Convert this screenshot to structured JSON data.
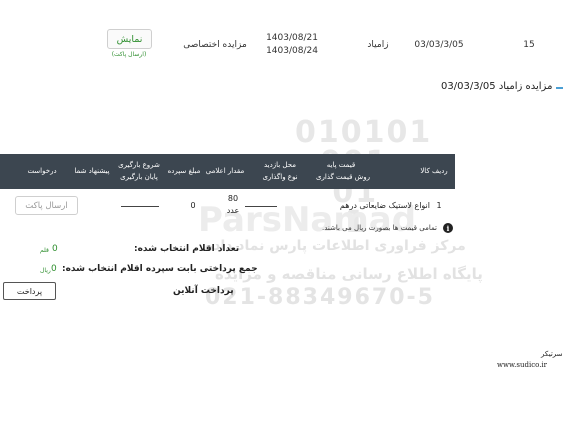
{
  "top_row": {
    "row_no": "15",
    "code": "03/03/3/05",
    "company": "زامیاد",
    "date_start": "1403/08/21",
    "date_end": "1403/08/24",
    "type": "مزایده اختصاصی",
    "show_label": "نمایش",
    "show_sub": "(ارسال پاکت)"
  },
  "section": {
    "title": "مزایده زامیاد 03/03/3/05"
  },
  "table": {
    "headers": {
      "row_item": "ردیف کالا",
      "base_price_line1": "قیمت پایه",
      "base_price_line2": "روش قیمت گذاری",
      "visit_line1": "محل بازدید",
      "visit_line2": "نوع واگذاری",
      "quantity": "مقدار اعلامی",
      "deposit": "مبلغ سپرده",
      "loading_line1": "شروع بارگیری",
      "loading_line2": "پایان بارگیری",
      "your_offer": "پیشنهاد شما",
      "request": "درخواست"
    },
    "row": {
      "index": "1",
      "item": "انواع لاستیک ضایعاتی درهم",
      "qty_value": "80",
      "qty_unit": "عدد",
      "deposit": "0",
      "send_label": "ارسال پاکت"
    }
  },
  "note": "تمامی قیمت ها بصورت ریال می باشند.",
  "summary": {
    "count_label": "تعداد اقلام انتخاب شده:",
    "count_value": "0",
    "count_unit": "قلم",
    "total_label": "جمع پرداختی بابت سپرده اقلام انتخاب شده:",
    "total_value": "0",
    "total_unit": "ریال"
  },
  "pay_button": "پرداخت",
  "online_pay": "پرداخت آنلاین",
  "footer": {
    "label": "سرتیکر",
    "site": "www.sudico.ir"
  },
  "watermark": {
    "digits": "010101\n  001\n   01\n    1",
    "brand": "ParsNamad",
    "line1": "مرکز فراوری اطلاعات پارس نماد داده",
    "line2": "پایگاه اطلاع رسانی مناقصه و مزایده",
    "phone": "021-88349670-5"
  },
  "colors": {
    "header_bg": "#3c4650",
    "accent": "#2f8f2f",
    "dash": "#4a9fd4"
  }
}
